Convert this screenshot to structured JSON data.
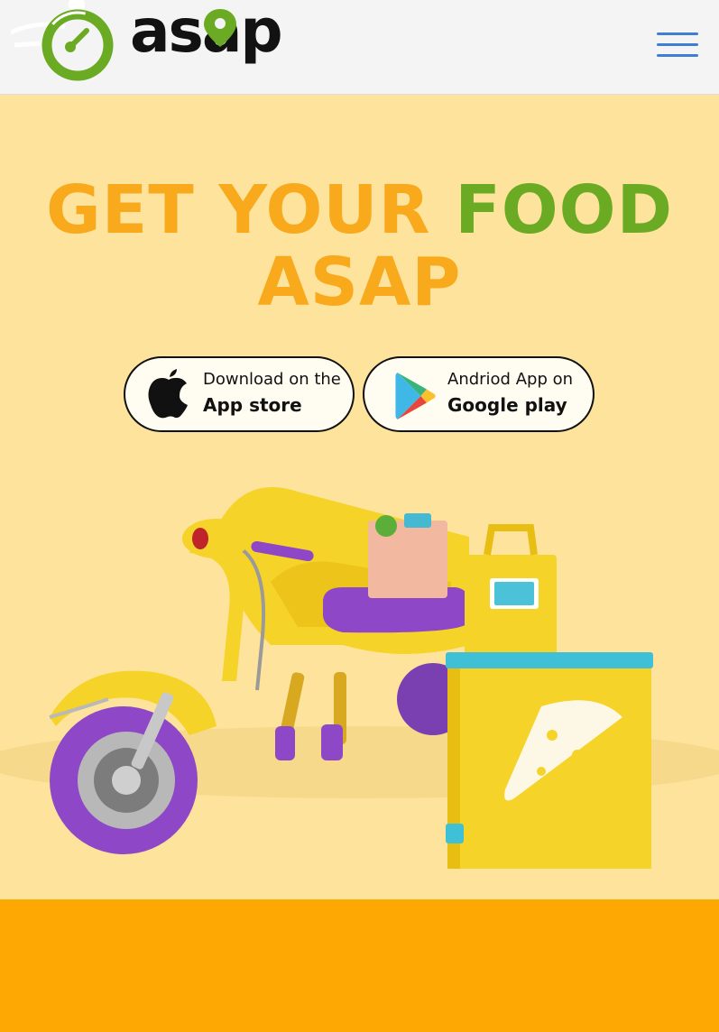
{
  "header": {
    "logo_text": "asap",
    "menu_icon": "hamburger-menu-icon"
  },
  "hero": {
    "headline_part1": "GET YOUR ",
    "headline_part2": "FOOD",
    "headline_part3": "ASAP",
    "apple": {
      "line1": "Download on the",
      "line2": "App store",
      "icon": "apple-icon"
    },
    "google": {
      "line1": "Andriod App on",
      "line2": "Google play",
      "icon": "google-play-icon"
    },
    "illustration": "delivery-scooter-illustration"
  },
  "colors": {
    "hero_bg": "#fde39c",
    "orange": "#f9a91c",
    "green": "#6bab23",
    "band": "#fea903",
    "menu": "#3f7ed3"
  }
}
